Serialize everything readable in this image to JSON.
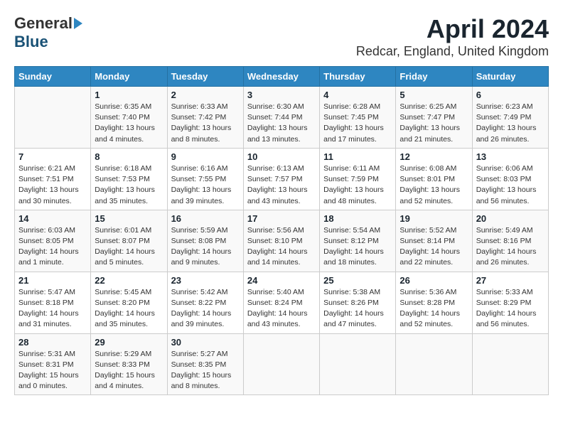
{
  "header": {
    "logo_general": "General",
    "logo_blue": "Blue",
    "month_title": "April 2024",
    "location": "Redcar, England, United Kingdom"
  },
  "days_of_week": [
    "Sunday",
    "Monday",
    "Tuesday",
    "Wednesday",
    "Thursday",
    "Friday",
    "Saturday"
  ],
  "weeks": [
    [
      {
        "num": "",
        "detail": ""
      },
      {
        "num": "1",
        "detail": "Sunrise: 6:35 AM\nSunset: 7:40 PM\nDaylight: 13 hours\nand 4 minutes."
      },
      {
        "num": "2",
        "detail": "Sunrise: 6:33 AM\nSunset: 7:42 PM\nDaylight: 13 hours\nand 8 minutes."
      },
      {
        "num": "3",
        "detail": "Sunrise: 6:30 AM\nSunset: 7:44 PM\nDaylight: 13 hours\nand 13 minutes."
      },
      {
        "num": "4",
        "detail": "Sunrise: 6:28 AM\nSunset: 7:45 PM\nDaylight: 13 hours\nand 17 minutes."
      },
      {
        "num": "5",
        "detail": "Sunrise: 6:25 AM\nSunset: 7:47 PM\nDaylight: 13 hours\nand 21 minutes."
      },
      {
        "num": "6",
        "detail": "Sunrise: 6:23 AM\nSunset: 7:49 PM\nDaylight: 13 hours\nand 26 minutes."
      }
    ],
    [
      {
        "num": "7",
        "detail": "Sunrise: 6:21 AM\nSunset: 7:51 PM\nDaylight: 13 hours\nand 30 minutes."
      },
      {
        "num": "8",
        "detail": "Sunrise: 6:18 AM\nSunset: 7:53 PM\nDaylight: 13 hours\nand 35 minutes."
      },
      {
        "num": "9",
        "detail": "Sunrise: 6:16 AM\nSunset: 7:55 PM\nDaylight: 13 hours\nand 39 minutes."
      },
      {
        "num": "10",
        "detail": "Sunrise: 6:13 AM\nSunset: 7:57 PM\nDaylight: 13 hours\nand 43 minutes."
      },
      {
        "num": "11",
        "detail": "Sunrise: 6:11 AM\nSunset: 7:59 PM\nDaylight: 13 hours\nand 48 minutes."
      },
      {
        "num": "12",
        "detail": "Sunrise: 6:08 AM\nSunset: 8:01 PM\nDaylight: 13 hours\nand 52 minutes."
      },
      {
        "num": "13",
        "detail": "Sunrise: 6:06 AM\nSunset: 8:03 PM\nDaylight: 13 hours\nand 56 minutes."
      }
    ],
    [
      {
        "num": "14",
        "detail": "Sunrise: 6:03 AM\nSunset: 8:05 PM\nDaylight: 14 hours\nand 1 minute."
      },
      {
        "num": "15",
        "detail": "Sunrise: 6:01 AM\nSunset: 8:07 PM\nDaylight: 14 hours\nand 5 minutes."
      },
      {
        "num": "16",
        "detail": "Sunrise: 5:59 AM\nSunset: 8:08 PM\nDaylight: 14 hours\nand 9 minutes."
      },
      {
        "num": "17",
        "detail": "Sunrise: 5:56 AM\nSunset: 8:10 PM\nDaylight: 14 hours\nand 14 minutes."
      },
      {
        "num": "18",
        "detail": "Sunrise: 5:54 AM\nSunset: 8:12 PM\nDaylight: 14 hours\nand 18 minutes."
      },
      {
        "num": "19",
        "detail": "Sunrise: 5:52 AM\nSunset: 8:14 PM\nDaylight: 14 hours\nand 22 minutes."
      },
      {
        "num": "20",
        "detail": "Sunrise: 5:49 AM\nSunset: 8:16 PM\nDaylight: 14 hours\nand 26 minutes."
      }
    ],
    [
      {
        "num": "21",
        "detail": "Sunrise: 5:47 AM\nSunset: 8:18 PM\nDaylight: 14 hours\nand 31 minutes."
      },
      {
        "num": "22",
        "detail": "Sunrise: 5:45 AM\nSunset: 8:20 PM\nDaylight: 14 hours\nand 35 minutes."
      },
      {
        "num": "23",
        "detail": "Sunrise: 5:42 AM\nSunset: 8:22 PM\nDaylight: 14 hours\nand 39 minutes."
      },
      {
        "num": "24",
        "detail": "Sunrise: 5:40 AM\nSunset: 8:24 PM\nDaylight: 14 hours\nand 43 minutes."
      },
      {
        "num": "25",
        "detail": "Sunrise: 5:38 AM\nSunset: 8:26 PM\nDaylight: 14 hours\nand 47 minutes."
      },
      {
        "num": "26",
        "detail": "Sunrise: 5:36 AM\nSunset: 8:28 PM\nDaylight: 14 hours\nand 52 minutes."
      },
      {
        "num": "27",
        "detail": "Sunrise: 5:33 AM\nSunset: 8:29 PM\nDaylight: 14 hours\nand 56 minutes."
      }
    ],
    [
      {
        "num": "28",
        "detail": "Sunrise: 5:31 AM\nSunset: 8:31 PM\nDaylight: 15 hours\nand 0 minutes."
      },
      {
        "num": "29",
        "detail": "Sunrise: 5:29 AM\nSunset: 8:33 PM\nDaylight: 15 hours\nand 4 minutes."
      },
      {
        "num": "30",
        "detail": "Sunrise: 5:27 AM\nSunset: 8:35 PM\nDaylight: 15 hours\nand 8 minutes."
      },
      {
        "num": "",
        "detail": ""
      },
      {
        "num": "",
        "detail": ""
      },
      {
        "num": "",
        "detail": ""
      },
      {
        "num": "",
        "detail": ""
      }
    ]
  ]
}
